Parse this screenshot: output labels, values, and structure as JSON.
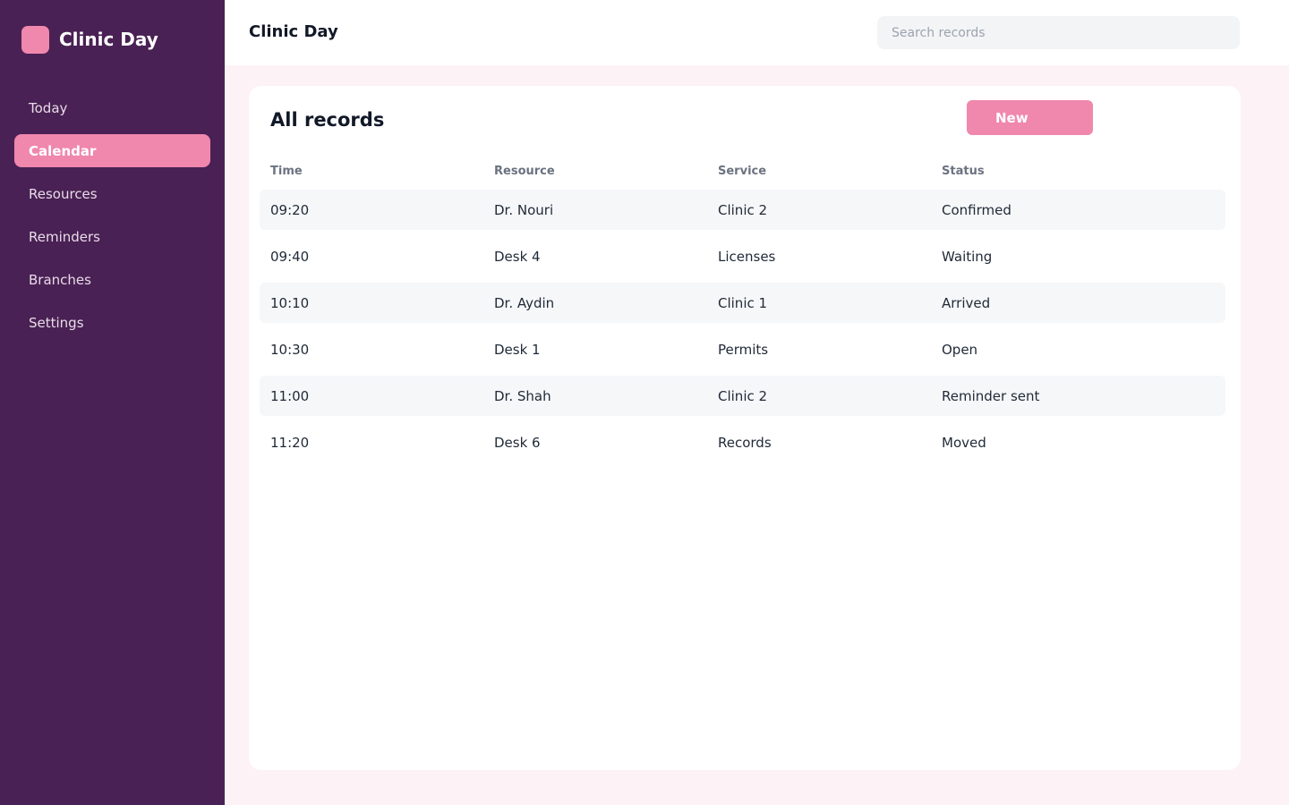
{
  "app": {
    "name": "Clinic Day"
  },
  "sidebar": {
    "items": [
      {
        "label": "Today",
        "active": false
      },
      {
        "label": "Calendar",
        "active": true
      },
      {
        "label": "Resources",
        "active": false
      },
      {
        "label": "Reminders",
        "active": false
      },
      {
        "label": "Branches",
        "active": false
      },
      {
        "label": "Settings",
        "active": false
      }
    ]
  },
  "header": {
    "title": "Clinic Day",
    "search_placeholder": "Search records"
  },
  "main": {
    "title": "All records",
    "new_button": "New",
    "columns": [
      "Time",
      "Resource",
      "Service",
      "Status"
    ],
    "rows": [
      [
        "09:20",
        "Dr. Nouri",
        "Clinic 2",
        "Confirmed"
      ],
      [
        "09:40",
        "Desk 4",
        "Licenses",
        "Waiting"
      ],
      [
        "10:10",
        "Dr. Aydin",
        "Clinic 1",
        "Arrived"
      ],
      [
        "10:30",
        "Desk 1",
        "Permits",
        "Open"
      ],
      [
        "11:00",
        "Dr. Shah",
        "Clinic 2",
        "Reminder sent"
      ],
      [
        "11:20",
        "Desk 6",
        "Records",
        "Moved"
      ]
    ]
  },
  "colors": {
    "sidebar_bg": "#4a2154",
    "accent": "#f087ad",
    "page_bg": "#fdf2f6"
  }
}
